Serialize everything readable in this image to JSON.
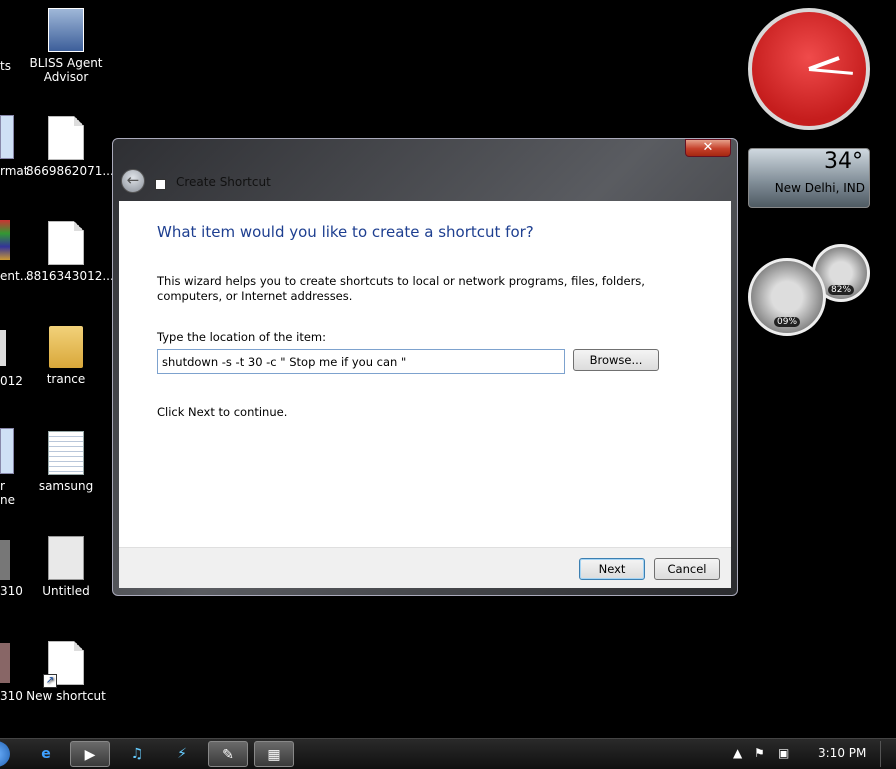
{
  "desktop": {
    "icons": [
      {
        "label": "BLISS Agent Advisor"
      },
      {
        "label": "8669862071..."
      },
      {
        "label": "8816343012..."
      },
      {
        "label": "trance"
      },
      {
        "label": "samsung"
      },
      {
        "label": "Untitled"
      },
      {
        "label": "New shortcut"
      }
    ],
    "edge_labels": [
      "ts",
      "rmat",
      "ent...",
      "012",
      "r",
      "ne",
      "310",
      "310"
    ]
  },
  "gadgets": {
    "weather": {
      "temp": "34°",
      "city": "New Delhi, IND"
    },
    "meter1_pct": "09%",
    "meter2_pct": "82%"
  },
  "dialog": {
    "title": "Create Shortcut",
    "close_label": "✕",
    "back_label": "←",
    "heading": "What item would you like to create a shortcut for?",
    "description": "This wizard helps you to create shortcuts to local or network programs, files, folders, computers, or Internet addresses.",
    "location_label": "Type the location of the item:",
    "location_value": "shutdown -s -t 30 -c \" Stop me if you can \"",
    "browse_label": "Browse...",
    "hint": "Click Next to continue.",
    "next_label": "Next",
    "cancel_label": "Cancel"
  },
  "taskbar": {
    "clock": "3:10 PM"
  }
}
